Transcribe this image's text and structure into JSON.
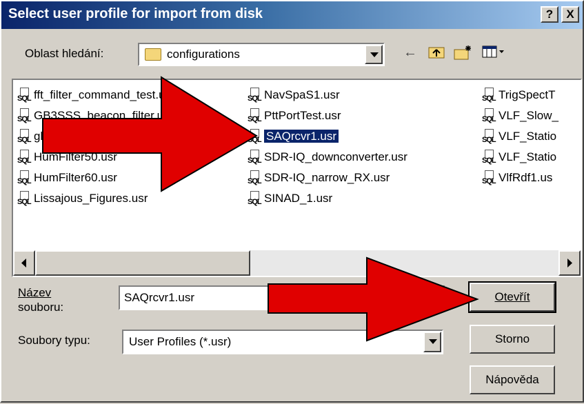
{
  "window": {
    "title": "Select user profile for import from disk",
    "help_btn": "?",
    "close_btn": "X"
  },
  "lookin": {
    "label": "Oblast hledání:",
    "value": "configurations"
  },
  "toolbar": {
    "back_icon": "back-arrow-icon",
    "up_icon": "up-folder-icon",
    "newfolder_icon": "new-folder-icon",
    "view_icon": "view-menu-icon"
  },
  "files": [
    "fft_filter_command_test.usr",
    "GB3SSS_beacon_filter.usr",
    "gb",
    "HumFilter50.usr",
    "HumFilter60.usr",
    "Lissajous_Figures.usr",
    "NavSpaS1.usr",
    "PttPortTest.usr",
    "SAQrcvr1.usr",
    "SDR-IQ_downconverter.usr",
    "SDR-IQ_narrow_RX.usr",
    "SINAD_1.usr",
    "TrigSpectT",
    "VLF_Slow_",
    "VLF_Statio",
    "VLF_Statio",
    "VlfRdf1.us"
  ],
  "icon_label": "SQL",
  "filename": {
    "label_line1": "Název",
    "label_line2": "souboru:",
    "value": "SAQrcvr1.usr"
  },
  "filetype": {
    "label": "Soubory typu:",
    "value": "User Profiles (*.usr)"
  },
  "buttons": {
    "open": "Otevřít",
    "cancel": "Storno",
    "help": "Nápověda"
  },
  "colors": {
    "arrow_fill": "#e00000",
    "selection": "#0a246a"
  }
}
